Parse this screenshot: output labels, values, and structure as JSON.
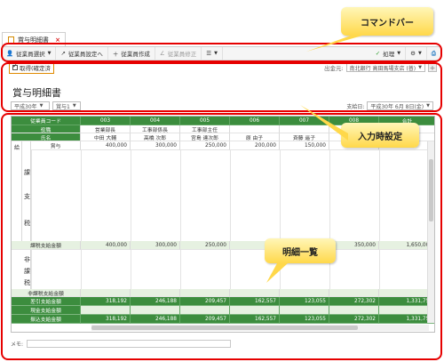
{
  "tab": {
    "label": "賞与明細書"
  },
  "toolbar": {
    "select_employee": "従業員選択",
    "employee_settings": "従業員設定へ",
    "create_employee": "従業員作成",
    "edit_employee": "従業員修正",
    "process": "処理"
  },
  "subbar": {
    "confirm_label": "取得(確定済",
    "source_label": "出金元:",
    "source_value": "南北銀行 高田馬場支店 (普)"
  },
  "page": {
    "title": "賞与明細書",
    "era_select": "平成30年",
    "bonus_select": "賞与1",
    "payday_label": "支給日:",
    "payday_value": "平成30年 6月 8日(金)"
  },
  "grid": {
    "header_rows": [
      {
        "label": "従業員コード",
        "values": [
          "003",
          "004",
          "005",
          "006",
          "007",
          "008",
          "合計"
        ]
      },
      {
        "label": "役職",
        "values": [
          "営業部長",
          "工事部係長",
          "工事部主任",
          "",
          "",
          "",
          ""
        ]
      },
      {
        "label": "氏名",
        "values": [
          "中田 大輔",
          "高橋 次郎",
          "宮島 達次郎",
          "原 由子",
          "斉藤 遥子",
          "",
          ""
        ]
      }
    ],
    "category_labels": {
      "taxable": [
        "課",
        "支",
        "税"
      ],
      "side": "給",
      "nontax": [
        "非",
        "課",
        "税"
      ]
    },
    "bonus_row": {
      "label": "賞与",
      "values": [
        "400,000",
        "300,000",
        "250,000",
        "200,000",
        "150,000",
        "",
        ""
      ]
    },
    "taxable_total": {
      "label": "課税支給金額",
      "values": [
        "400,000",
        "300,000",
        "250,000",
        "",
        "",
        "350,000",
        "1,650,000"
      ]
    },
    "nontax_total": {
      "label": "非課税支給金額",
      "values": [
        "",
        "",
        "",
        "",
        "",
        "",
        ""
      ]
    },
    "footer_rows": [
      {
        "label": "差引支給金額",
        "values": [
          "318,192",
          "246,188",
          "209,457",
          "162,557",
          "123,055",
          "272,302",
          "1,331,751"
        ]
      },
      {
        "label": "現金支給金額",
        "values": [
          "",
          "",
          "",
          "",
          "",
          "",
          ""
        ]
      },
      {
        "label": "振込支給金額",
        "values": [
          "318,192",
          "246,188",
          "209,457",
          "162,557",
          "123,055",
          "272,302",
          "1,331,751"
        ]
      }
    ]
  },
  "memo": {
    "label": "メモ:"
  },
  "annotations": {
    "command_bar": "コマンドバー",
    "input_settings": "入力時設定",
    "detail_list": "明細一覧"
  },
  "colors": {
    "header_green": "#3c8d3e",
    "highlight_red": "#e60000",
    "callout_yellow": "#ffd84a"
  }
}
